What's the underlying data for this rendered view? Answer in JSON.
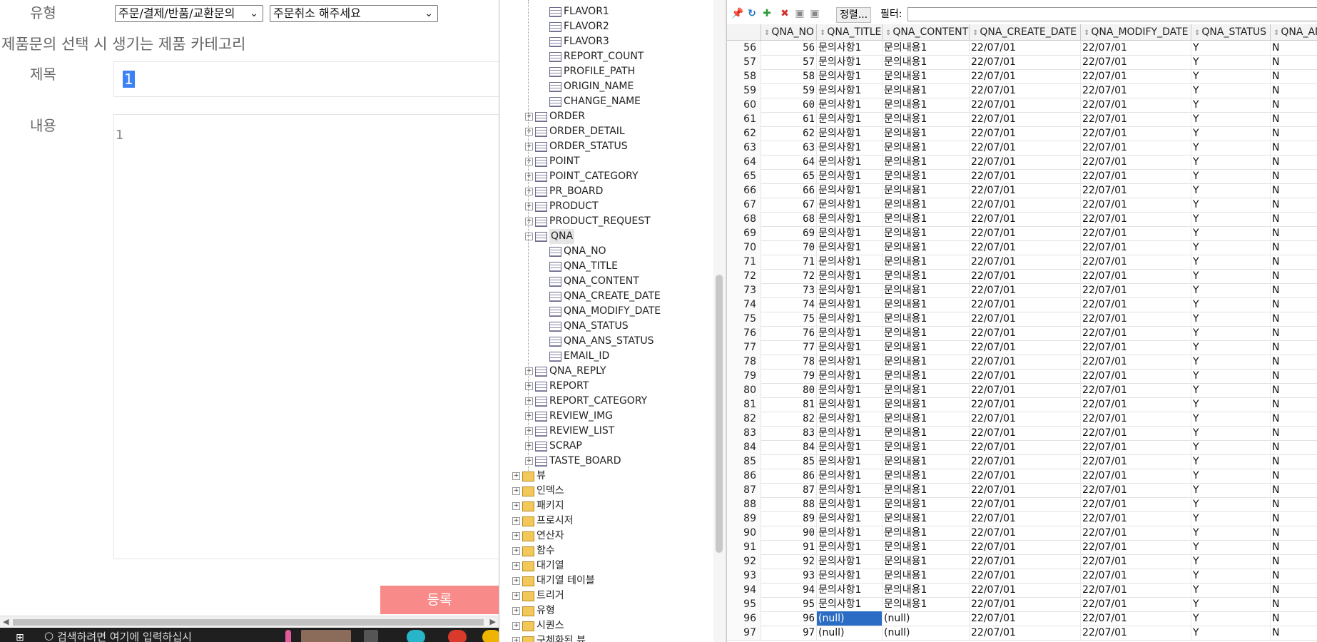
{
  "form": {
    "type_label": "유형",
    "type_select_1": "주문/결제/반품/교환문의",
    "type_select_2": "주문취소 해주세요",
    "category_hint": "제품문의 선택 시 생기는 제품 카테고리",
    "title_label": "제목",
    "title_value": "1",
    "content_label": "내용",
    "content_value": "1",
    "submit_label": "등록"
  },
  "taskbar": {
    "search_text": "검색하려면 여기에 입력하십시"
  },
  "tree": {
    "columns_above": [
      "FLAVOR1",
      "FLAVOR2",
      "FLAVOR3",
      "REPORT_COUNT",
      "PROFILE_PATH",
      "ORIGIN_NAME",
      "CHANGE_NAME"
    ],
    "tables_a": [
      "ORDER",
      "ORDER_DETAIL",
      "ORDER_STATUS",
      "POINT",
      "POINT_CATEGORY",
      "PR_BOARD",
      "PRODUCT",
      "PRODUCT_REQUEST"
    ],
    "qna_table": "QNA",
    "qna_columns": [
      "QNA_NO",
      "QNA_TITLE",
      "QNA_CONTENT",
      "QNA_CREATE_DATE",
      "QNA_MODIFY_DATE",
      "QNA_STATUS",
      "QNA_ANS_STATUS",
      "EMAIL_ID"
    ],
    "tables_b": [
      "QNA_REPLY",
      "REPORT",
      "REPORT_CATEGORY",
      "REVIEW_IMG",
      "REVIEW_LIST",
      "SCRAP",
      "TASTE_BOARD"
    ],
    "groups": [
      "뷰",
      "인덱스",
      "패키지",
      "프로시저",
      "연산자",
      "함수",
      "대기열",
      "대기열 테이블",
      "트리거",
      "유형",
      "시퀀스",
      "구체화된 뷰"
    ]
  },
  "toolbar": {
    "sort_label": "정렬...",
    "filter_label": "필터:",
    "icons": [
      "pin-icon",
      "refresh-icon",
      "insert-row-icon",
      "delete-row-icon",
      "commit-icon",
      "rollback-icon"
    ]
  },
  "grid": {
    "headers": [
      "QNA_NO",
      "QNA_TITLE",
      "QNA_CONTENT",
      "QNA_CREATE_DATE",
      "QNA_MODIFY_DATE",
      "QNA_STATUS",
      "QNA_AN"
    ],
    "rows": [
      [
        "56",
        "56",
        "문의사항1",
        "문의내용1",
        "22/07/01",
        "22/07/01",
        "Y",
        "N"
      ],
      [
        "57",
        "57",
        "문의사항1",
        "문의내용1",
        "22/07/01",
        "22/07/01",
        "Y",
        "N"
      ],
      [
        "58",
        "58",
        "문의사항1",
        "문의내용1",
        "22/07/01",
        "22/07/01",
        "Y",
        "N"
      ],
      [
        "59",
        "59",
        "문의사항1",
        "문의내용1",
        "22/07/01",
        "22/07/01",
        "Y",
        "N"
      ],
      [
        "60",
        "60",
        "문의사항1",
        "문의내용1",
        "22/07/01",
        "22/07/01",
        "Y",
        "N"
      ],
      [
        "61",
        "61",
        "문의사항1",
        "문의내용1",
        "22/07/01",
        "22/07/01",
        "Y",
        "N"
      ],
      [
        "62",
        "62",
        "문의사항1",
        "문의내용1",
        "22/07/01",
        "22/07/01",
        "Y",
        "N"
      ],
      [
        "63",
        "63",
        "문의사항1",
        "문의내용1",
        "22/07/01",
        "22/07/01",
        "Y",
        "N"
      ],
      [
        "64",
        "64",
        "문의사항1",
        "문의내용1",
        "22/07/01",
        "22/07/01",
        "Y",
        "N"
      ],
      [
        "65",
        "65",
        "문의사항1",
        "문의내용1",
        "22/07/01",
        "22/07/01",
        "Y",
        "N"
      ],
      [
        "66",
        "66",
        "문의사항1",
        "문의내용1",
        "22/07/01",
        "22/07/01",
        "Y",
        "N"
      ],
      [
        "67",
        "67",
        "문의사항1",
        "문의내용1",
        "22/07/01",
        "22/07/01",
        "Y",
        "N"
      ],
      [
        "68",
        "68",
        "문의사항1",
        "문의내용1",
        "22/07/01",
        "22/07/01",
        "Y",
        "N"
      ],
      [
        "69",
        "69",
        "문의사항1",
        "문의내용1",
        "22/07/01",
        "22/07/01",
        "Y",
        "N"
      ],
      [
        "70",
        "70",
        "문의사항1",
        "문의내용1",
        "22/07/01",
        "22/07/01",
        "Y",
        "N"
      ],
      [
        "71",
        "71",
        "문의사항1",
        "문의내용1",
        "22/07/01",
        "22/07/01",
        "Y",
        "N"
      ],
      [
        "72",
        "72",
        "문의사항1",
        "문의내용1",
        "22/07/01",
        "22/07/01",
        "Y",
        "N"
      ],
      [
        "73",
        "73",
        "문의사항1",
        "문의내용1",
        "22/07/01",
        "22/07/01",
        "Y",
        "N"
      ],
      [
        "74",
        "74",
        "문의사항1",
        "문의내용1",
        "22/07/01",
        "22/07/01",
        "Y",
        "N"
      ],
      [
        "75",
        "75",
        "문의사항1",
        "문의내용1",
        "22/07/01",
        "22/07/01",
        "Y",
        "N"
      ],
      [
        "76",
        "76",
        "문의사항1",
        "문의내용1",
        "22/07/01",
        "22/07/01",
        "Y",
        "N"
      ],
      [
        "77",
        "77",
        "문의사항1",
        "문의내용1",
        "22/07/01",
        "22/07/01",
        "Y",
        "N"
      ],
      [
        "78",
        "78",
        "문의사항1",
        "문의내용1",
        "22/07/01",
        "22/07/01",
        "Y",
        "N"
      ],
      [
        "79",
        "79",
        "문의사항1",
        "문의내용1",
        "22/07/01",
        "22/07/01",
        "Y",
        "N"
      ],
      [
        "80",
        "80",
        "문의사항1",
        "문의내용1",
        "22/07/01",
        "22/07/01",
        "Y",
        "N"
      ],
      [
        "81",
        "81",
        "문의사항1",
        "문의내용1",
        "22/07/01",
        "22/07/01",
        "Y",
        "N"
      ],
      [
        "82",
        "82",
        "문의사항1",
        "문의내용1",
        "22/07/01",
        "22/07/01",
        "Y",
        "N"
      ],
      [
        "83",
        "83",
        "문의사항1",
        "문의내용1",
        "22/07/01",
        "22/07/01",
        "Y",
        "N"
      ],
      [
        "84",
        "84",
        "문의사항1",
        "문의내용1",
        "22/07/01",
        "22/07/01",
        "Y",
        "N"
      ],
      [
        "85",
        "85",
        "문의사항1",
        "문의내용1",
        "22/07/01",
        "22/07/01",
        "Y",
        "N"
      ],
      [
        "86",
        "86",
        "문의사항1",
        "문의내용1",
        "22/07/01",
        "22/07/01",
        "Y",
        "N"
      ],
      [
        "87",
        "87",
        "문의사항1",
        "문의내용1",
        "22/07/01",
        "22/07/01",
        "Y",
        "N"
      ],
      [
        "88",
        "88",
        "문의사항1",
        "문의내용1",
        "22/07/01",
        "22/07/01",
        "Y",
        "N"
      ],
      [
        "89",
        "89",
        "문의사항1",
        "문의내용1",
        "22/07/01",
        "22/07/01",
        "Y",
        "N"
      ],
      [
        "90",
        "90",
        "문의사항1",
        "문의내용1",
        "22/07/01",
        "22/07/01",
        "Y",
        "N"
      ],
      [
        "91",
        "91",
        "문의사항1",
        "문의내용1",
        "22/07/01",
        "22/07/01",
        "Y",
        "N"
      ],
      [
        "92",
        "92",
        "문의사항1",
        "문의내용1",
        "22/07/01",
        "22/07/01",
        "Y",
        "N"
      ],
      [
        "93",
        "93",
        "문의사항1",
        "문의내용1",
        "22/07/01",
        "22/07/01",
        "Y",
        "N"
      ],
      [
        "94",
        "94",
        "문의사항1",
        "문의내용1",
        "22/07/01",
        "22/07/01",
        "Y",
        "N"
      ],
      [
        "95",
        "95",
        "문의사항1",
        "문의내용1",
        "22/07/01",
        "22/07/01",
        "Y",
        "N"
      ],
      [
        "96",
        "96",
        "(null)",
        "(null)",
        "22/07/01",
        "22/07/01",
        "Y",
        "N"
      ],
      [
        "97",
        "97",
        "(null)",
        "(null)",
        "22/07/01",
        "22/07/01",
        "Y",
        "N"
      ]
    ],
    "selected_row": "96"
  },
  "colors": {
    "submit_bg": "#f88a8a",
    "selection_blue": "#2b6cc4"
  }
}
